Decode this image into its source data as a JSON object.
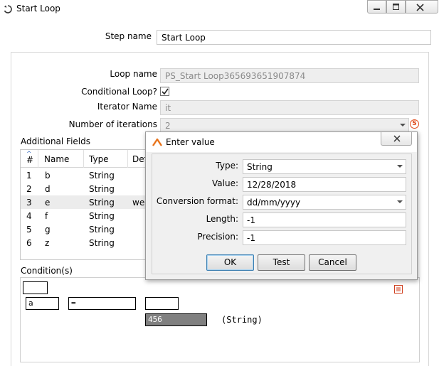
{
  "window": {
    "title": "Start Loop"
  },
  "form": {
    "step_name_label": "Step name",
    "step_name_value": "Start Loop",
    "loop_name_label": "Loop name",
    "loop_name_value": "PS_Start Loop365693651907874",
    "conditional_loop_label": "Conditional Loop?",
    "conditional_loop_checked": true,
    "iterator_name_label": "Iterator Name",
    "iterator_name_value": "it",
    "iterations_label": "Number of iterations",
    "iterations_value": "2",
    "additional_fields_label": "Additional Fields",
    "conditions_label": "Condition(s)"
  },
  "table": {
    "headers": {
      "num": "#",
      "name": "Name",
      "type": "Type",
      "default": "Def"
    },
    "rows": [
      {
        "num": "1",
        "name": "b",
        "type": "String",
        "default": ""
      },
      {
        "num": "2",
        "name": "d",
        "type": "String",
        "default": ""
      },
      {
        "num": "3",
        "name": "e",
        "type": "String",
        "default": "wee"
      },
      {
        "num": "4",
        "name": "f",
        "type": "String",
        "default": ""
      },
      {
        "num": "5",
        "name": "g",
        "type": "String",
        "default": ""
      },
      {
        "num": "6",
        "name": "z",
        "type": "String",
        "default": ""
      }
    ]
  },
  "condition": {
    "field": "a",
    "operator": "=",
    "value": "456",
    "value_type": "(String)"
  },
  "dialog": {
    "title": "Enter value",
    "type_label": "Type:",
    "type_value": "String",
    "value_label": "Value:",
    "value_value": "12/28/2018",
    "format_label": "Conversion format:",
    "format_value": "dd/mm/yyyy",
    "length_label": "Length:",
    "length_value": "-1",
    "precision_label": "Precision:",
    "precision_value": "-1",
    "ok_label": "OK",
    "test_label": "Test",
    "cancel_label": "Cancel"
  },
  "colors": {
    "accent": "#e8731a",
    "selected_row": "#ececec",
    "value_box": "#808080"
  }
}
